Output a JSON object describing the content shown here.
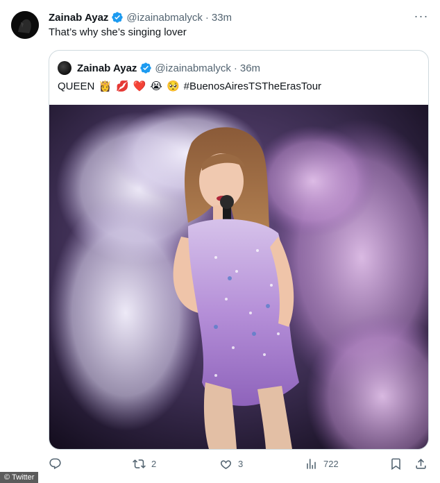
{
  "tweet": {
    "name": "Zainab Ayaz",
    "handle": "@izainabmalyck",
    "separator": "·",
    "time": "33m",
    "text": "That’s why she’s singing lover",
    "more_label": "···"
  },
  "quoted": {
    "name": "Zainab Ayaz",
    "handle": "@izainabmalyck",
    "separator": "·",
    "time": "36m",
    "text_prefix": "QUEEN",
    "emojis": [
      "👸",
      "💋",
      "❤️",
      "😭",
      "🥺"
    ],
    "hashtag": "#BuenosAiresTSTheErasTour",
    "image_alt": "photo"
  },
  "actions": {
    "reply_count": "",
    "retweet_count": "2",
    "like_count": "3",
    "views_count": "722"
  },
  "credit": "© Twitter",
  "colors": {
    "verified": "#1d9bf0",
    "muted": "#536471",
    "text": "#0f1419",
    "border": "#cfd9de"
  }
}
